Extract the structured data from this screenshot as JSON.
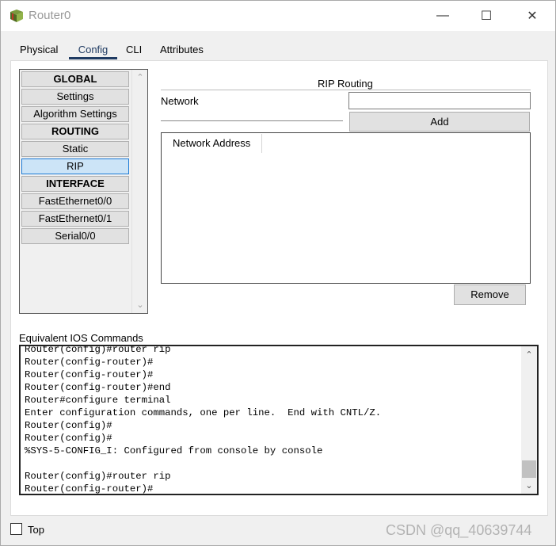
{
  "window": {
    "title": "Router0",
    "minimize": "—",
    "maximize": "☐",
    "close": "✕"
  },
  "tabs": [
    {
      "label": "Physical"
    },
    {
      "label": "Config"
    },
    {
      "label": "CLI"
    },
    {
      "label": "Attributes"
    }
  ],
  "sidebar": {
    "items": [
      {
        "label": "GLOBAL"
      },
      {
        "label": "Settings"
      },
      {
        "label": "Algorithm Settings"
      },
      {
        "label": "ROUTING"
      },
      {
        "label": "Static"
      },
      {
        "label": "RIP"
      },
      {
        "label": "INTERFACE"
      },
      {
        "label": "FastEthernet0/0"
      },
      {
        "label": "FastEthernet0/1"
      },
      {
        "label": "Serial0/0"
      }
    ]
  },
  "rip": {
    "title": "RIP Routing",
    "network_label": "Network",
    "network_value": "",
    "add_label": "Add",
    "column_header": "Network Address",
    "remove_label": "Remove"
  },
  "ios": {
    "label": "Equivalent IOS Commands",
    "lines": "Router(config)#router rip\nRouter(config-router)#\nRouter(config-router)#\nRouter(config-router)#end\nRouter#configure terminal\nEnter configuration commands, one per line.  End with CNTL/Z.\nRouter(config)#\nRouter(config)#\n%SYS-5-CONFIG_I: Configured from console by console\n\nRouter(config)#router rip\nRouter(config-router)#"
  },
  "footer": {
    "top_label": "Top",
    "watermark": "CSDN @qq_40639744"
  },
  "colors": {
    "accent": "#1f3b62",
    "selected": "#cce4f7"
  }
}
